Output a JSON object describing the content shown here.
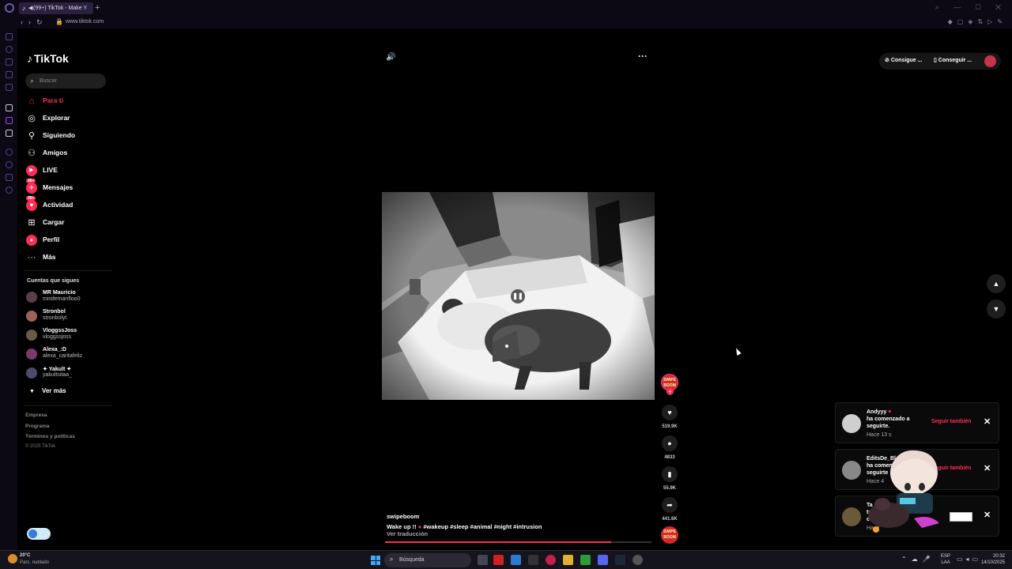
{
  "browser": {
    "tab_title": "(99+) TikTok - Make Y",
    "url": "www.tiktok.com"
  },
  "tiktok": {
    "logo": "TikTok",
    "search_placeholder": "Buscar",
    "nav": [
      {
        "label": "Para ti",
        "icon": "home-icon",
        "active": true
      },
      {
        "label": "Explorar",
        "icon": "compass-icon"
      },
      {
        "label": "Siguiendo",
        "icon": "following-icon"
      },
      {
        "label": "Amigos",
        "icon": "friends-icon"
      },
      {
        "label": "LIVE",
        "icon": "live-icon"
      },
      {
        "label": "Mensajes",
        "icon": "messages-icon",
        "badge": "99+"
      },
      {
        "label": "Actividad",
        "icon": "activity-icon",
        "badge": "99+"
      },
      {
        "label": "Cargar",
        "icon": "upload-icon"
      },
      {
        "label": "Perfil",
        "icon": "profile-icon"
      },
      {
        "label": "Más",
        "icon": "more-icon"
      }
    ],
    "following_title": "Cuentas que sigues",
    "following": [
      {
        "name": "MR Mauricio",
        "handle": "minifemanfloo0"
      },
      {
        "name": "Stronbol",
        "handle": "stronbolyt"
      },
      {
        "name": "VloggssJoss",
        "handle": "vloggssjoss"
      },
      {
        "name": "Alexa_:D",
        "handle": "alexa_caritafeliz"
      },
      {
        "name": "Yakult",
        "handle": "yakultsitaa_"
      }
    ],
    "see_more": "Ver más",
    "footer": [
      "Empresa",
      "Programa",
      "Términos y políticas"
    ],
    "copyright": "© 2025 TikTok",
    "top_right": {
      "coins": "Consigue ...",
      "app": "Conseguir ..."
    },
    "video": {
      "author": "swipeboom",
      "caption": "Wake up !!",
      "hashtags": "#wakeup #sleep #animal #night #intrusion",
      "translate": "Ver traducción",
      "progress": 0.85,
      "likes": "519.9K",
      "comments": "4833",
      "saves": "55.9K",
      "shares": "441.6K",
      "creator_badge": "SWIPE BOOM"
    },
    "notifications": [
      {
        "name": "Andyyy",
        "text": "ha comenzado a",
        "text2": "seguirte.",
        "time": "Hace 13 s",
        "action": "Seguir también"
      },
      {
        "name": "EditsDe_Bl",
        "text": "ha comen",
        "text2": "seguirte",
        "time": "Hace 4",
        "action": "Seguir también"
      },
      {
        "name": "Ta",
        "text": "te me",
        "text2": "con",
        "time": "Hace"
      }
    ]
  },
  "taskbar": {
    "temp": "20°C",
    "condition": "Parc. nublado",
    "search": "Búsqueda",
    "lang1": "ESP",
    "lang2": "LAA",
    "time": "20:32",
    "date": "14/10/2025"
  },
  "colors": {
    "accent": "#fe2c55",
    "background": "#000000"
  }
}
